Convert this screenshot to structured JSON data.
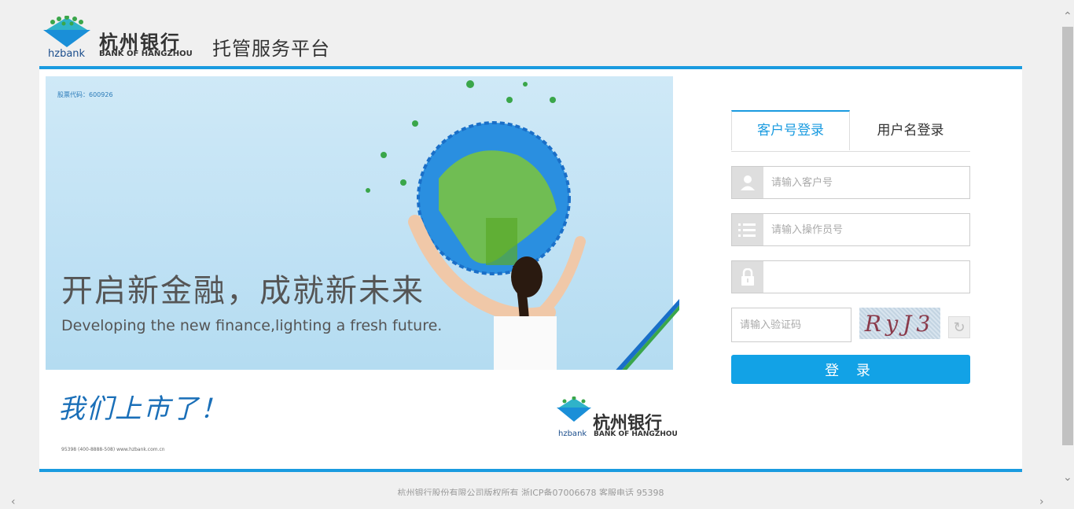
{
  "header": {
    "logo_cn": "杭州银行",
    "logo_en": "BANK OF HANGZHOU",
    "logo_short": "hzbank",
    "platform_title": "托管服务平台"
  },
  "banner": {
    "stock_code": "股票代码：600926",
    "slogan_cn": "开启新金融，成就新未来",
    "slogan_en": "Developing the new finance,lighting a fresh future.",
    "handwriting": "我们上市了！",
    "contact": "95398 (400-8888-508)    www.hzbank.com.cn",
    "logo_cn": "杭州银行",
    "logo_en": "BANK OF HANGZHOU",
    "logo_short": "hzbank"
  },
  "login": {
    "tabs": [
      {
        "label": "客户号登录",
        "active": true
      },
      {
        "label": "用户名登录",
        "active": false
      }
    ],
    "customer_no_placeholder": "请输入客户号",
    "operator_no_placeholder": "请输入操作员号",
    "password_placeholder": "",
    "captcha_placeholder": "请输入验证码",
    "captcha_text": "RyJ3",
    "submit_label": "登 录"
  },
  "footer": {
    "text": "杭州银行股份有限公司版权所有   浙ICP备07006678   客服电话  95398"
  },
  "colors": {
    "accent": "#1a9be0",
    "button": "#12a2e6",
    "background": "#f0f0f0"
  }
}
